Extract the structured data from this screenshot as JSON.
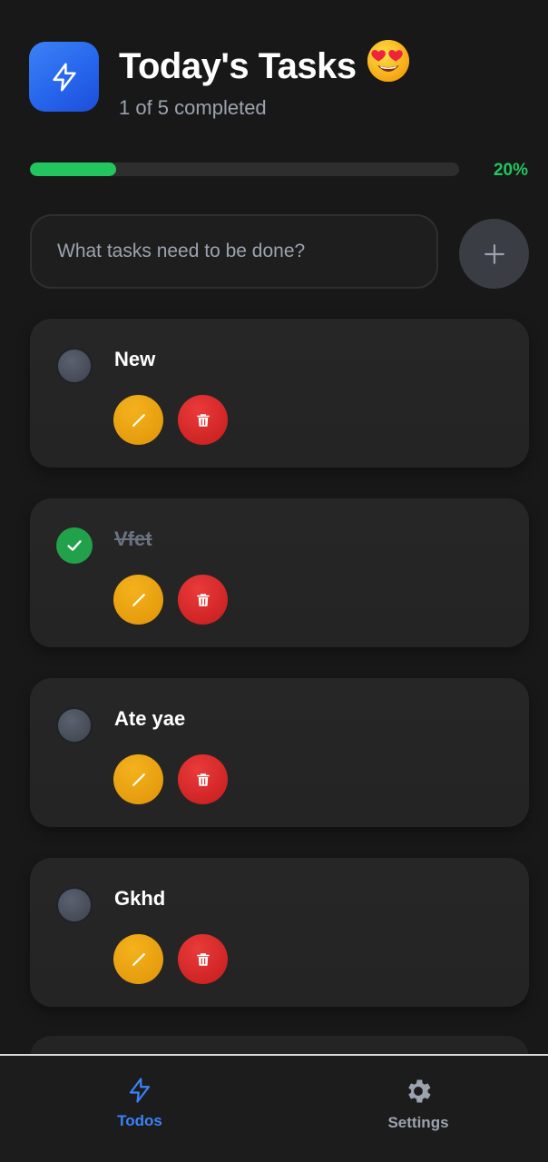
{
  "header": {
    "title": "Today's Tasks",
    "subtitle": "1 of 5 completed",
    "logo_icon": "lightning-bolt-icon",
    "emoji": "heart-eyes-emoji"
  },
  "progress": {
    "value": 0.2,
    "label": "20%",
    "color": "#22c55e"
  },
  "task_input": {
    "placeholder": "What tasks need to be done?",
    "value": ""
  },
  "add_button": {
    "icon": "plus-icon"
  },
  "tasks": [
    {
      "title": "New",
      "completed": false
    },
    {
      "title": "Vfet",
      "completed": true
    },
    {
      "title": "Ate yae",
      "completed": false
    },
    {
      "title": "Gkhd",
      "completed": false
    }
  ],
  "nav": {
    "items": [
      {
        "label": "Todos",
        "icon": "lightning-bolt-icon",
        "active": true
      },
      {
        "label": "Settings",
        "icon": "gear-icon",
        "active": false
      }
    ],
    "active_color": "#3b82f6",
    "inactive_color": "#9ca3af"
  },
  "colors": {
    "background": "#181818",
    "accent": "#2563eb",
    "edit": "#e39a0c",
    "delete": "#cc2222",
    "completed": "#22a14b"
  }
}
